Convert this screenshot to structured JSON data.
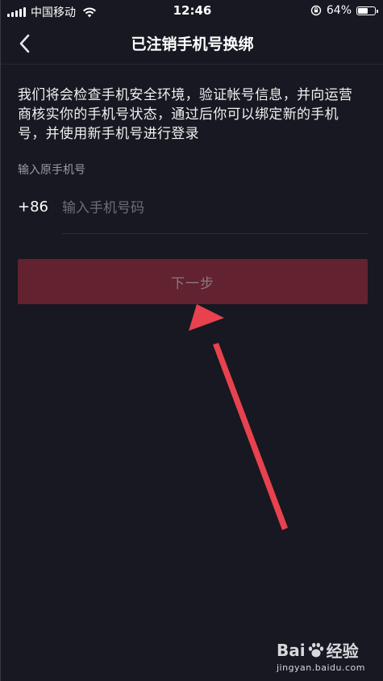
{
  "status_bar": {
    "carrier": "中国移动",
    "time": "12:46",
    "battery_percent": "64%",
    "battery_level": 0.64
  },
  "nav": {
    "title": "已注销手机号换绑",
    "back_icon": "chevron-left-icon"
  },
  "main": {
    "description": "我们将会检查手机安全环境，验证帐号信息，并向运营商核实你的手机号状态，通过后你可以绑定新的手机号，并使用新手机号进行登录",
    "field_label": "输入原手机号",
    "country_code": "+86",
    "phone_placeholder": "输入手机号码",
    "phone_value": "",
    "next_label": "下一步"
  },
  "watermark": {
    "brand_left": "Bai",
    "brand_right": "经验",
    "url": "jingyan.baidu.com"
  },
  "colors": {
    "background": "#171821",
    "button": "#62222f",
    "annotation_arrow": "#e8424f"
  }
}
